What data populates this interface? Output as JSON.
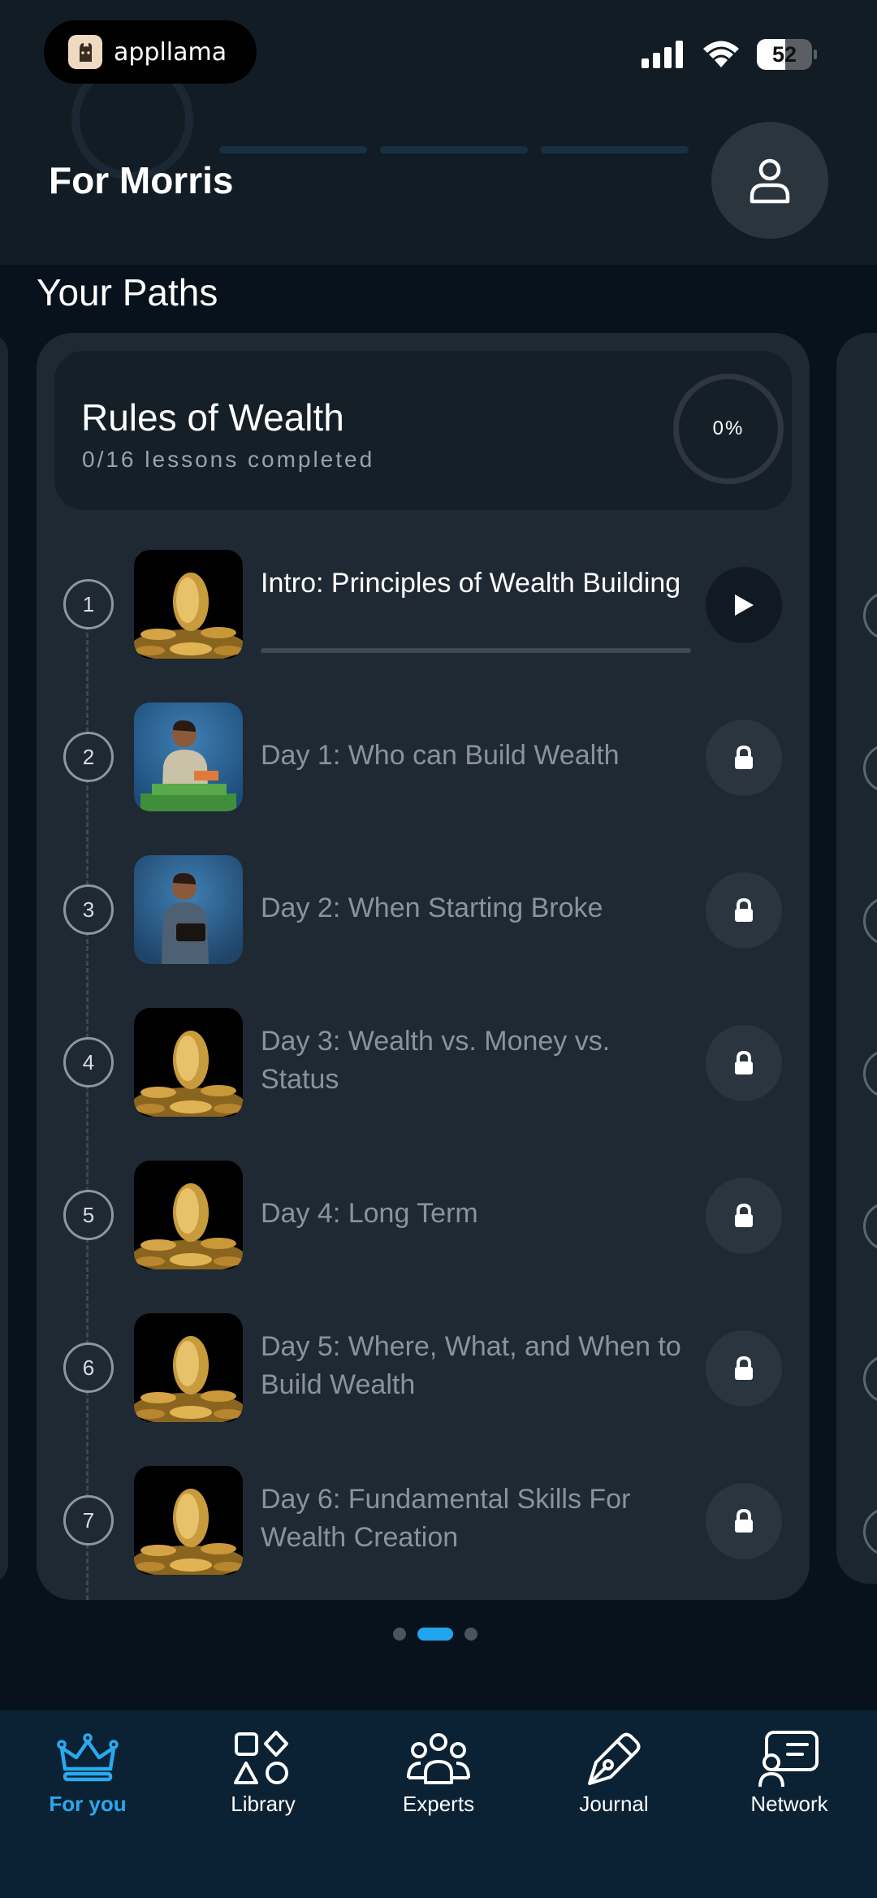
{
  "status_bar": {
    "app_badge": "appllama",
    "battery": {
      "level_text": "52",
      "level_fraction": 0.52
    },
    "icons": [
      "signal-icon",
      "wifi-icon",
      "battery-icon"
    ]
  },
  "header": {
    "title": "For Morris",
    "profile_icon": "person-icon"
  },
  "paths": {
    "section_title": "Your Paths",
    "current_page": 2,
    "page_count": 3,
    "card": {
      "title": "Rules of Wealth",
      "subtitle": "0/16 lessons completed",
      "progress_text": "0%",
      "progress_fraction": 0.0
    },
    "lessons": [
      {
        "number": "1",
        "title": "Intro: Principles of Wealth Building",
        "state": "unlocked",
        "action_icon": "play-icon",
        "thumbnail": "gold-coins"
      },
      {
        "number": "2",
        "title": "Day 1: Who can Build Wealth",
        "state": "locked",
        "action_icon": "lock-icon",
        "thumbnail": "man-with-money"
      },
      {
        "number": "3",
        "title": "Day 2: When Starting Broke",
        "state": "locked",
        "action_icon": "lock-icon",
        "thumbnail": "man-with-wallet"
      },
      {
        "number": "4",
        "title": "Day 3: Wealth vs. Money vs. Status",
        "state": "locked",
        "action_icon": "lock-icon",
        "thumbnail": "gold-coins"
      },
      {
        "number": "5",
        "title": "Day 4: Long Term",
        "state": "locked",
        "action_icon": "lock-icon",
        "thumbnail": "gold-coins"
      },
      {
        "number": "6",
        "title": "Day 5: Where, What, and When to Build Wealth",
        "state": "locked",
        "action_icon": "lock-icon",
        "thumbnail": "gold-coins"
      },
      {
        "number": "7",
        "title": "Day 6: Fundamental Skills For Wealth Creation",
        "state": "locked",
        "action_icon": "lock-icon",
        "thumbnail": "gold-coins"
      }
    ]
  },
  "nav": [
    {
      "label": "For you",
      "icon": "crown-icon",
      "active": true
    },
    {
      "label": "Library",
      "icon": "shapes-icon",
      "active": false
    },
    {
      "label": "Experts",
      "icon": "people-icon",
      "active": false
    },
    {
      "label": "Journal",
      "icon": "pen-icon",
      "active": false
    },
    {
      "label": "Network",
      "icon": "chat-person-icon",
      "active": false
    }
  ],
  "colors": {
    "accent": "#21a5ee",
    "background": "#07121c",
    "card": "#1e2933",
    "nav_background": "#0b2134"
  }
}
